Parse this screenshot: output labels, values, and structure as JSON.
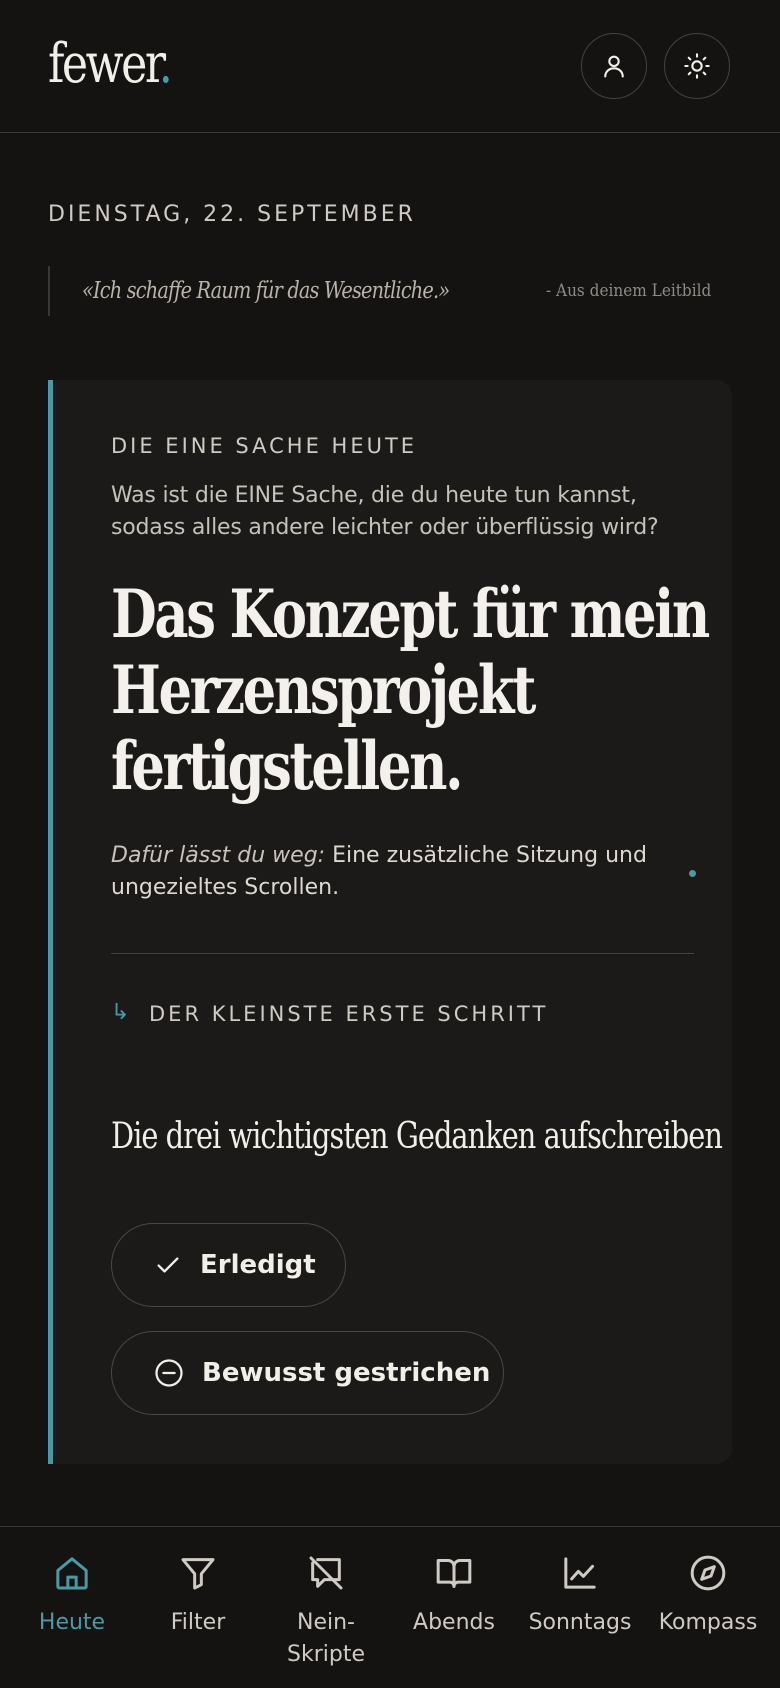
{
  "app": {
    "logo_text": "fewer",
    "logo_dot": ".",
    "accent_color": "#4a9aa5"
  },
  "header": {
    "user_icon": "user-icon",
    "theme_icon": "sun-icon"
  },
  "today": {
    "date": "DIENSTAG, 22. SEPTEMBER",
    "quote": "«Ich schaffe Raum für das Wesentliche.»",
    "quote_source": "- Aus deinem Leitbild"
  },
  "card": {
    "eyebrow": "DIE EINE SACHE HEUTE",
    "prompt": "Was ist die EINE Sache, die du heute tun kannst, sodass alles andere leichter oder überflüssig wird?",
    "headline": "Das Konzept für mein Herzensprojekt fertigstellen.",
    "skip_label": "Dafür lässt du weg:",
    "skip_text": "Eine zusätzliche Sitzung und ungezieltes Scrollen.",
    "step_arrow": "↳",
    "step_label": "DER KLEINSTE ERSTE SCHRITT",
    "step_text": "Die drei wichtigsten Gedanken aufschreiben",
    "done_button": "Erledigt",
    "skipped_button": "Bewusst gestrichen"
  },
  "tabs": [
    {
      "label": "Heute",
      "icon": "home-icon",
      "active": true
    },
    {
      "label": "Filter",
      "icon": "filter-icon",
      "active": false
    },
    {
      "label": "Nein-\nSkripte",
      "icon": "message-off-icon",
      "active": false
    },
    {
      "label": "Abends",
      "icon": "book-open-icon",
      "active": false
    },
    {
      "label": "Sonntags",
      "icon": "chart-line-icon",
      "active": false
    },
    {
      "label": "Kompass",
      "icon": "compass-icon",
      "active": false
    }
  ]
}
